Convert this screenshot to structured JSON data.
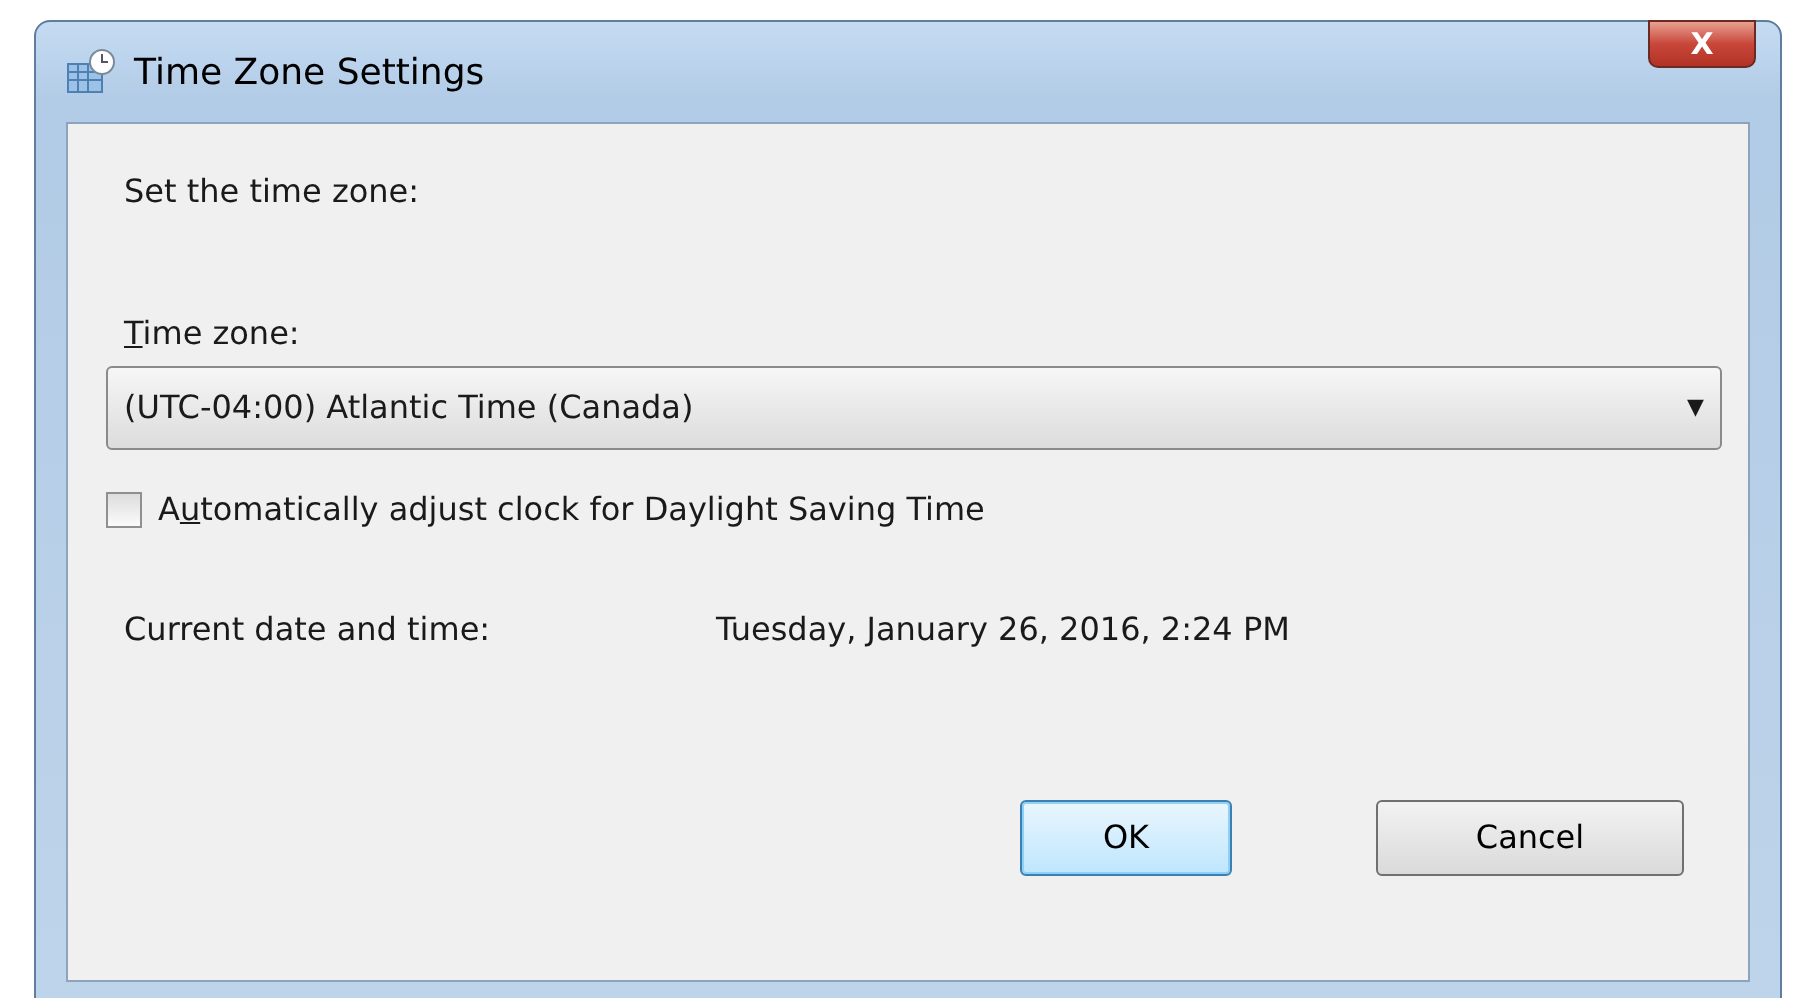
{
  "window": {
    "title": "Time Zone Settings",
    "close_label": "X"
  },
  "instruction": "Set the time zone:",
  "time_zone": {
    "label": {
      "key": "T",
      "after": "ime zone:"
    },
    "value": "(UTC-04:00) Atlantic Time (Canada)",
    "arrow": "▼"
  },
  "daylight_saving": {
    "label": {
      "before": "A",
      "key": "u",
      "after": "tomatically adjust clock for Daylight Saving Time"
    },
    "checked": false
  },
  "current": {
    "label": "Current date and time:",
    "value": "Tuesday, January 26, 2016, 2:24 PM"
  },
  "buttons": [
    {
      "label": "OK",
      "default": true
    },
    {
      "label": "Cancel",
      "default": false
    }
  ]
}
